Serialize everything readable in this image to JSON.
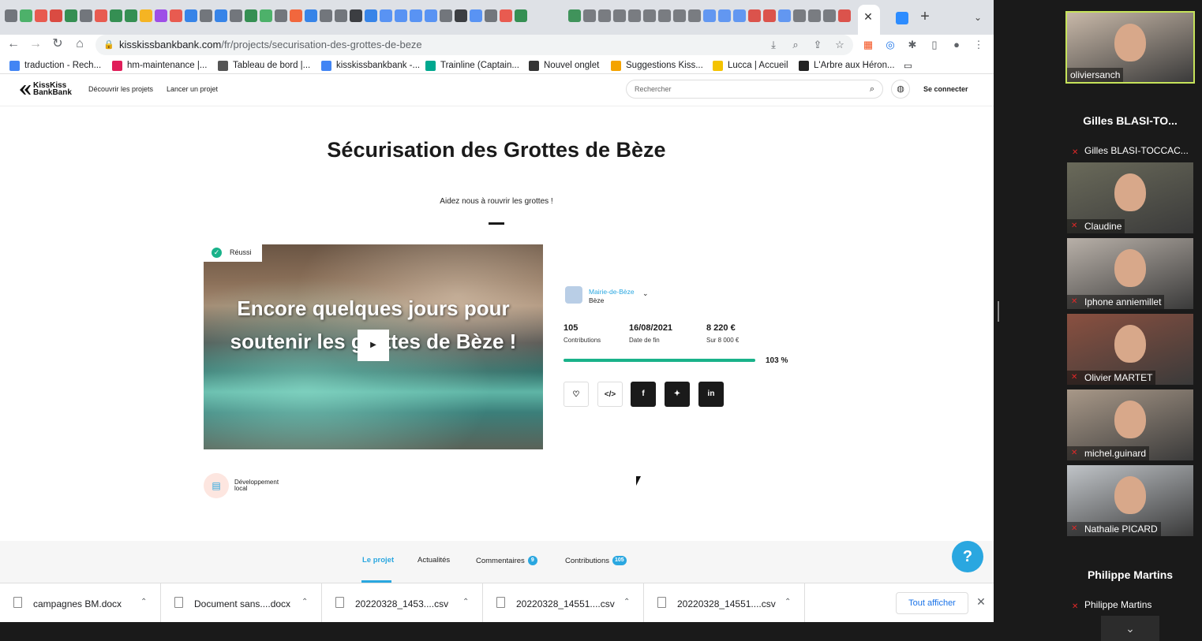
{
  "browser": {
    "url_domain": "kisskissbankbank.com",
    "url_path": "/fr/projects/securisation-des-grottes-de-beze",
    "bookmarks": [
      {
        "label": "traduction - Rech...",
        "color": "#4285f4"
      },
      {
        "label": "hm-maintenance |...",
        "color": "#e01e5a"
      },
      {
        "label": "Tableau de bord |...",
        "color": "#555555"
      },
      {
        "label": "kisskissbankbank -...",
        "color": "#4285f4"
      },
      {
        "label": "Trainline (Captain...",
        "color": "#00a88f"
      },
      {
        "label": "Nouvel onglet",
        "color": "#333333"
      },
      {
        "label": "Suggestions Kiss...",
        "color": "#f4a300"
      },
      {
        "label": "Lucca | Accueil",
        "color": "#f4c300"
      },
      {
        "label": "L'Arbre aux Héron...",
        "color": "#222222"
      }
    ]
  },
  "site": {
    "logo": "KissKiss BankBank",
    "nav": [
      "Découvrir les projets",
      "Lancer un projet"
    ],
    "search_placeholder": "Rechercher",
    "login": "Se connecter"
  },
  "project": {
    "title": "Sécurisation des Grottes de Bèze",
    "subtitle": "Aidez nous à rouvrir les grottes !",
    "badge": "Réussi",
    "video_text": "Encore quelques jours pour soutenir les grottes de Bèze !",
    "owner": "Mairie-de-Bèze",
    "location": "Bèze",
    "stats": [
      {
        "value": "105",
        "label": "Contributions"
      },
      {
        "value": "16/08/2021",
        "label": "Date de fin"
      },
      {
        "value": "8 220 €",
        "label": "Sur 8 000 €"
      }
    ],
    "progress_pct_label": "103 %",
    "progress_fraction": 1.0,
    "category": "Développement local",
    "tabs": [
      {
        "label": "Le projet",
        "count": ""
      },
      {
        "label": "Actualités",
        "count": ""
      },
      {
        "label": "Commentaires",
        "count": "9"
      },
      {
        "label": "Contributions",
        "count": "105"
      }
    ],
    "share_buttons": [
      "heart-icon",
      "embed-icon",
      "facebook-icon",
      "twitter-icon",
      "linkedin-icon"
    ],
    "accent_color": "#2aa7e0",
    "success_color": "#19b28a"
  },
  "downloads": {
    "files": [
      "campagnes BM.docx",
      "Document sans....docx",
      "20220328_1453....csv",
      "20220328_14551....csv",
      "20220328_14551....csv"
    ],
    "show_all": "Tout afficher"
  },
  "zoom": {
    "participants_video": [
      {
        "name": "oliviersanch",
        "bg": "#c8b8a8"
      },
      {
        "name": "Claudine",
        "bg": "#6a6a5a"
      },
      {
        "name": "Iphone anniemillet",
        "bg": "#b8b0a8"
      },
      {
        "name": "Olivier MARTET",
        "bg": "#8a5040"
      },
      {
        "name": "michel.guinard",
        "bg": "#a89888"
      },
      {
        "name": "Nathalie PICARD",
        "bg": "#c0c4c8"
      }
    ],
    "participant_names": [
      {
        "title": "Gilles BLASI-TO...",
        "sub": "Gilles BLASI-TOCCAC..."
      },
      {
        "title": "Philippe Martins",
        "sub": "Philippe Martins"
      }
    ]
  }
}
